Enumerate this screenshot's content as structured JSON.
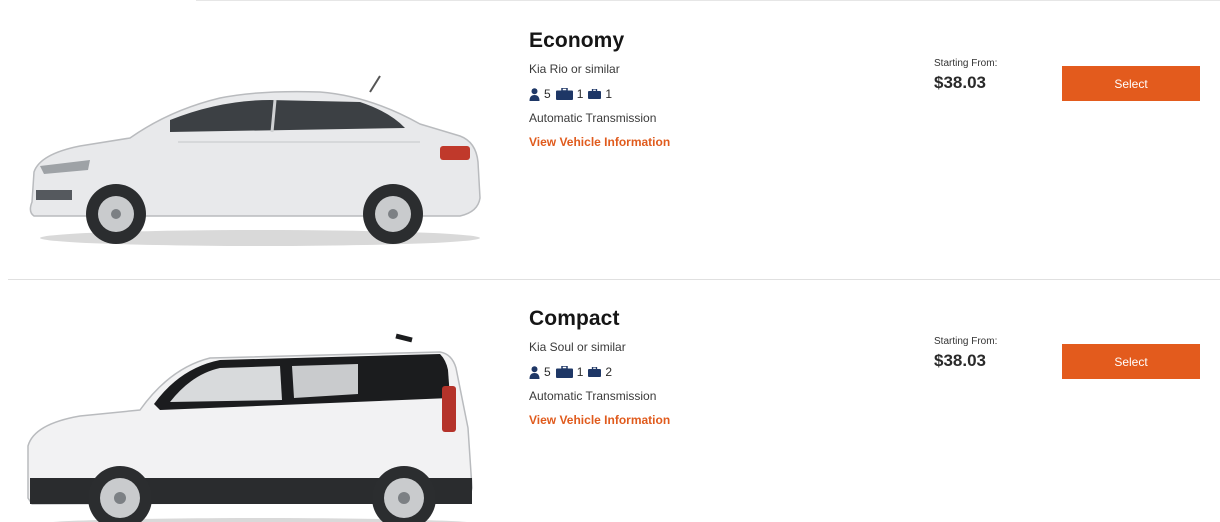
{
  "vehicles": [
    {
      "class": "Economy",
      "model": "Kia Rio or similar",
      "passengers": "5",
      "large_bags": "1",
      "small_bags": "1",
      "transmission": "Automatic Transmission",
      "info_link": "View Vehicle Information",
      "price_label": "Starting From:",
      "price": "$38.03",
      "select_label": "Select"
    },
    {
      "class": "Compact",
      "model": "Kia Soul or similar",
      "passengers": "5",
      "large_bags": "1",
      "small_bags": "2",
      "transmission": "Automatic Transmission",
      "info_link": "View Vehicle Information",
      "price_label": "Starting From:",
      "price": "$38.03",
      "select_label": "Select"
    }
  ],
  "colors": {
    "accent": "#e35b1d",
    "icon": "#1e3766",
    "divider": "#e0e0e0"
  },
  "icons": {
    "passenger": "person-icon",
    "large_bag": "suitcase-icon",
    "small_bag": "small-bag-icon"
  }
}
